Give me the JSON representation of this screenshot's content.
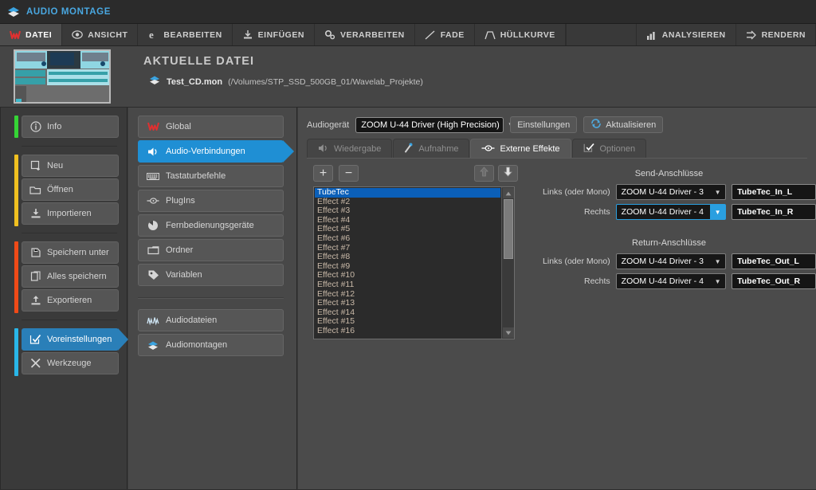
{
  "window": {
    "title": "AUDIO MONTAGE",
    "title_icon": "audio-montage-icon"
  },
  "menubar": {
    "items": [
      {
        "label": "DATEI",
        "icon": "wavelab-w-icon",
        "active": true
      },
      {
        "label": "ANSICHT",
        "icon": "eye-icon",
        "active": false
      },
      {
        "label": "BEARBEITEN",
        "icon": "edit-e-icon",
        "active": false
      },
      {
        "label": "EINFÜGEN",
        "icon": "insert-icon",
        "active": false
      },
      {
        "label": "VERARBEITEN",
        "icon": "gears-icon",
        "active": false
      },
      {
        "label": "FADE",
        "icon": "fade-slope-icon",
        "active": false
      },
      {
        "label": "HÜLLKURVE",
        "icon": "envelope-curve-icon",
        "active": false
      }
    ],
    "right_items": [
      {
        "label": "ANALYSIEREN",
        "icon": "bar-chart-icon"
      },
      {
        "label": "RENDERN",
        "icon": "render-arrow-icon"
      }
    ]
  },
  "file_header": {
    "section_title": "AKTUELLE DATEI",
    "file_icon": "audio-montage-icon",
    "file_name": "Test_CD.mon",
    "file_path": "(/Volumes/STP_SSD_500GB_01/Wavelab_Projekte)"
  },
  "sidebar_left": {
    "groups": [
      {
        "accent": "#35d435",
        "items": [
          {
            "label": "Info",
            "icon": "info-circle-icon",
            "selected": false
          }
        ]
      },
      {
        "accent": "#f0c020",
        "items": [
          {
            "label": "Neu",
            "icon": "new-document-icon",
            "selected": false
          },
          {
            "label": "Öffnen",
            "icon": "folder-open-icon",
            "selected": false
          },
          {
            "label": "Importieren",
            "icon": "import-download-icon",
            "selected": false
          }
        ]
      },
      {
        "accent": "#f04a18",
        "items": [
          {
            "label": "Speichern unter",
            "icon": "save-as-icon",
            "selected": false
          },
          {
            "label": "Alles speichern",
            "icon": "save-all-icon",
            "selected": false
          },
          {
            "label": "Exportieren",
            "icon": "export-upload-icon",
            "selected": false
          }
        ]
      },
      {
        "accent": "#29b6e8",
        "items": [
          {
            "label": "Voreinstellungen",
            "icon": "preferences-check-icon",
            "selected": true
          },
          {
            "label": "Werkzeuge",
            "icon": "tools-cross-icon",
            "selected": false
          }
        ]
      }
    ]
  },
  "sidebar_mid": {
    "groups": [
      {
        "items": [
          {
            "label": "Global",
            "icon": "wavelab-w-icon",
            "selected": false
          },
          {
            "label": "Audio-Verbindungen",
            "icon": "speaker-icon",
            "selected": true
          },
          {
            "label": "Tastaturbefehle",
            "icon": "keyboard-icon",
            "selected": false
          },
          {
            "label": "PlugIns",
            "icon": "plug-connector-icon",
            "selected": false
          },
          {
            "label": "Fernbedienungsgeräte",
            "icon": "remote-knob-icon",
            "selected": false
          },
          {
            "label": "Ordner",
            "icon": "folder-icon",
            "selected": false
          },
          {
            "label": "Variablen",
            "icon": "tag-icon",
            "selected": false
          }
        ]
      },
      {
        "items": [
          {
            "label": "Audiodateien",
            "icon": "waveform-icon",
            "selected": false
          },
          {
            "label": "Audiomontagen",
            "icon": "audio-montage-icon",
            "selected": false
          }
        ]
      }
    ]
  },
  "main": {
    "device_row": {
      "label": "Audiogerät",
      "device_value": "ZOOM U-44 Driver (High Precision)",
      "dropdown_arrow": "▼",
      "settings_button": "Einstellungen",
      "refresh_button": "Aktualisieren",
      "refresh_icon": "refresh-arrows-icon"
    },
    "tabs": [
      {
        "label": "Wiedergabe",
        "icon": "speaker-icon",
        "active": false
      },
      {
        "label": "Aufnahme",
        "icon": "microphone-icon",
        "active": false
      },
      {
        "label": "Externe Effekte",
        "icon": "plug-connector-icon",
        "active": true
      },
      {
        "label": "Optionen",
        "icon": "options-check-icon",
        "active": false
      }
    ],
    "list_toolbar": {
      "add_label": "+",
      "remove_label": "−",
      "move_up_icon": "arrow-up-icon",
      "move_down_icon": "arrow-down-icon"
    },
    "effects_list": {
      "selected_index": 0,
      "items": [
        "TubeTec",
        "Effect #2",
        "Effect #3",
        "Effect #4",
        "Effect #5",
        "Effect #6",
        "Effect #7",
        "Effect #8",
        "Effect #9",
        "Effect #10",
        "Effect #11",
        "Effect #12",
        "Effect #13",
        "Effect #14",
        "Effect #15",
        "Effect #16"
      ]
    },
    "send_section": {
      "title": "Send-Anschlüsse",
      "rows": [
        {
          "label": "Links (oder Mono)",
          "device": "ZOOM U-44 Driver - 3",
          "name": "TubeTec_In_L",
          "focused": false
        },
        {
          "label": "Rechts",
          "device": "ZOOM U-44 Driver - 4",
          "name": "TubeTec_In_R",
          "focused": true
        }
      ]
    },
    "return_section": {
      "title": "Return-Anschlüsse",
      "rows": [
        {
          "label": "Links (oder Mono)",
          "device": "ZOOM U-44 Driver - 3",
          "name": "TubeTec_Out_L",
          "focused": false
        },
        {
          "label": "Rechts",
          "device": "ZOOM U-44 Driver - 4",
          "name": "TubeTec_Out_R",
          "focused": false
        }
      ]
    }
  },
  "colors": {
    "accent_blue": "#1f8fd4",
    "selection_blue": "#0b5fb8",
    "title_blue": "#49a7e0",
    "panel_bg": "#4b4b4b"
  }
}
